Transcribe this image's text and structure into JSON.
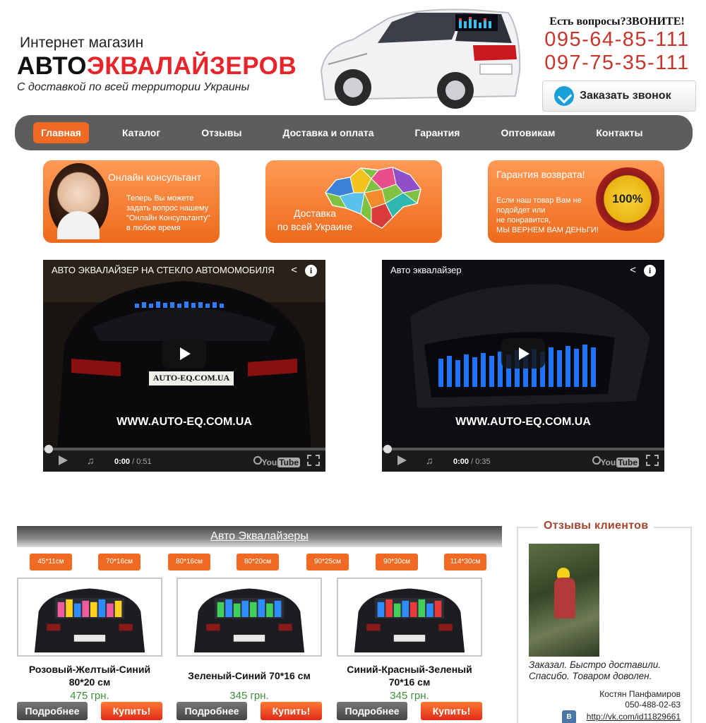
{
  "header": {
    "tagline_top": "Интернет магазин",
    "brand_part1": "АВТО",
    "brand_part2": "ЭКВАЛАЙЗЕРОВ",
    "subtitle": "С доставкой по всей территории Украины",
    "questions": "Есть вопросы?ЗВОНИТЕ!",
    "phones": [
      "095-64-85-111",
      "097-75-35-111"
    ],
    "callback_label": "Заказать звонок"
  },
  "nav": {
    "items": [
      {
        "label": "Главная",
        "active": true
      },
      {
        "label": "Каталог",
        "active": false
      },
      {
        "label": "Отзывы",
        "active": false
      },
      {
        "label": "Доставка и оплата",
        "active": false
      },
      {
        "label": "Гарантия",
        "active": false
      },
      {
        "label": "Оптовикам",
        "active": false
      },
      {
        "label": "Контакты",
        "active": false
      }
    ]
  },
  "banners": {
    "consultant": {
      "title": "Онлайн консультант",
      "text": [
        "Теперь Вы можете",
        "задать вопрос нашему",
        "\"Онлайн Консультанту\"",
        "в любое время"
      ]
    },
    "delivery": {
      "text": [
        "Доставка",
        "по всей Украине"
      ]
    },
    "guarantee": {
      "title": "Гарантия возврата!",
      "text": [
        "Если наш товар Вам не",
        "подойдет или",
        "не понравится,",
        "МЫ ВЕРНЕМ ВАМ ДЕНЬГИ!"
      ],
      "seal": "100%"
    }
  },
  "videos": [
    {
      "title": "АВТО ЭКВАЛАЙЗЕР НА СТЕКЛО АВТОМОМОБИЛЯ",
      "url_overlay": "WWW.AUTO-EQ.COM.UA",
      "plate": "AUTO-EQ.COM.UA",
      "current": "0:00",
      "duration": "/ 0:51",
      "yt": "You",
      "yt2": "Tube"
    },
    {
      "title": "Авто эквалайзер",
      "url_overlay": "WWW.AUTO-EQ.COM.UA",
      "current": "0:00",
      "duration": "/ 0:35",
      "yt": "You",
      "yt2": "Tube"
    }
  ],
  "catalog": {
    "heading": "Авто Эквалайзеры",
    "sizes": [
      "45*11см",
      "70*16см",
      "80*16см",
      "80*20см",
      "90*25см",
      "90*30см",
      "114*30см"
    ],
    "products": [
      {
        "name": "Розовый-Желтый-Синий 80*20 см",
        "price": "475 грн.",
        "more": "Подробнее",
        "buy": "Купить!"
      },
      {
        "name": "Зеленый-Синий 70*16 см",
        "price": "345 грн.",
        "more": "Подробнее",
        "buy": "Купить!"
      },
      {
        "name": "Синий-Красный-Зеленый 70*16 см",
        "price": "345 грн.",
        "more": "Подробнее",
        "buy": "Купить!"
      }
    ]
  },
  "reviews": {
    "title": "Отзывы клиентов",
    "quote": "Заказал. Быстро доставили. Спасибо. Товаром доволен.",
    "author": "Костян Панфамиров",
    "phone": "050-488-02-63",
    "vk_icon": "В",
    "link": "http://vk.com/id11829661"
  },
  "colors": {
    "accent": "#f06a23",
    "brand_red": "#e8242b",
    "nav_bg": "#5d5d5d",
    "price_green": "#3d8f3d",
    "phone": "#c7352b"
  }
}
